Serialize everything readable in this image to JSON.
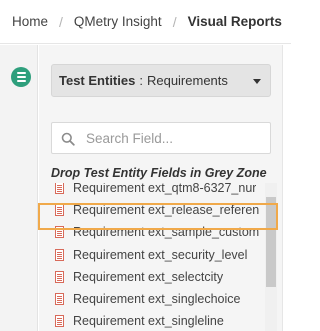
{
  "breadcrumb": {
    "items": [
      {
        "label": "Home"
      },
      {
        "label": "QMetry Insight"
      },
      {
        "label": "Visual Reports"
      }
    ],
    "separator": "/"
  },
  "sidebar": {
    "icon": "list-icon",
    "accent": "#2e9f7c"
  },
  "entity_select": {
    "label": "Test Entities",
    "separator": ":",
    "value": "Requirements"
  },
  "search": {
    "placeholder": "Search Field...",
    "value": ""
  },
  "zone_title": "Drop Test Entity Fields in Grey Zone",
  "fields": [
    {
      "label": "Requirement ext_qtm8-6327_nur"
    },
    {
      "label": "Requirement ext_release_referen"
    },
    {
      "label": "Requirement ext_sample_custom"
    },
    {
      "label": "Requirement ext_security_level"
    },
    {
      "label": "Requirement ext_selectcity"
    },
    {
      "label": "Requirement ext_singlechoice"
    },
    {
      "label": "Requirement ext_singleline"
    }
  ],
  "highlighted_field_index": 1,
  "colors": {
    "highlight": "#f0a94a",
    "field_icon": "#d86a5a"
  }
}
